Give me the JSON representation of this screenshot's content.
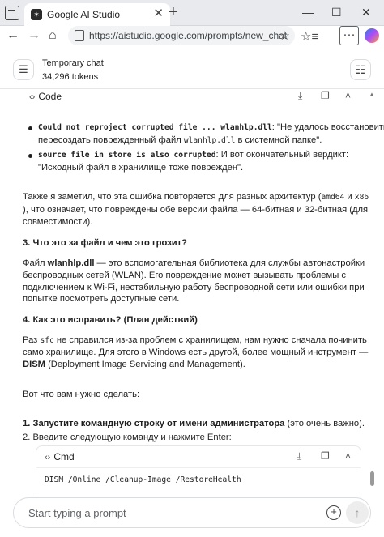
{
  "browser": {
    "tab_title": "Google AI Studio",
    "tab_favicon": "✶",
    "tab_close": "✕",
    "new_tab": "+",
    "window_controls": {
      "minimize": "—",
      "maximize": "☐",
      "close": "✕"
    },
    "nav": {
      "back": "←",
      "forward": "→",
      "home": "⌂"
    },
    "url": "https://aistudio.google.com/prompts/new_chat",
    "star_icon": "☆",
    "favorites_icon": "☆≡",
    "more_icon": "···"
  },
  "header": {
    "sidebar_icon": "☰",
    "title": "Temporary chat",
    "tokens": "34,296 tokens",
    "settings_icon": "☷"
  },
  "code_block_top": {
    "chevron": "‹›",
    "label": "Code",
    "download_icon": "⤓",
    "copy_icon": "❐",
    "collapse_icon": "˄"
  },
  "bullets": [
    {
      "code": "Could not reproject corrupted file ... wlanhlp.dll",
      "text1": ": \"Не удалось восстановить/",
      "text2a": "пересоздать поврежденный файл ",
      "code2": "wlanhlp.dll",
      "text2b": " в системной папке\"."
    },
    {
      "code": "source file in store is also corrupted",
      "text1": ": И вот окончательный вердикт:",
      "text2a": "\"Исходный файл в хранилище тоже поврежден\"."
    }
  ],
  "para_arch": {
    "l1a": "Также я заметил, что эта ошибка повторяется для разных архитектур (",
    "code1": "amd64",
    "l1b": " и ",
    "code2": "x86",
    "l2": "), что означает, что повреждены обе версии файла — 64-битная и 32-битная (для",
    "l3": "совместимости)."
  },
  "heading3": "3. Что это за файл и чем это грозит?",
  "para_file": {
    "l1a": "Файл ",
    "l1b": "wlanhlp.dll",
    "l1c": " — это вспомогательная библиотека для службы автонастройки",
    "l2": "беспроводных сетей (WLAN). Его повреждение может вызывать проблемы с",
    "l3": "подключением к Wi-Fi, нестабильную работу беспроводной сети или ошибки при",
    "l4": "попытке посмотреть доступные сети."
  },
  "heading4": "4. Как это исправить? (План действий)",
  "para_fix": {
    "l1a": "Раз ",
    "code": "sfc",
    "l1b": " не справился из-за проблем с хранилищем, нам нужно сначала починить",
    "l2": "само хранилище. Для этого в Windows есть другой, более мощный инструмент —",
    "l3a": "DISM",
    "l3b": " (Deployment Image Servicing and Management)."
  },
  "para_todo": "Вот что вам нужно сделать:",
  "steps": [
    {
      "num": "1.",
      "bold": "Запустите командную строку от имени администратора",
      "rest": " (это очень важно)."
    },
    {
      "num": "2.",
      "bold": "",
      "rest": "Введите следующую команду и нажмите Enter:"
    }
  ],
  "cmd_block": {
    "chevron": "‹›",
    "label": "Cmd",
    "download_icon": "⤓",
    "copy_icon": "❐",
    "collapse_icon": "˄",
    "command": "DISM /Online /Cleanup-Image /RestoreHealth"
  },
  "prompt": {
    "placeholder": "Start typing a prompt",
    "add_icon": "+",
    "send_icon": "↑"
  },
  "scroll_up_icon": "▲"
}
